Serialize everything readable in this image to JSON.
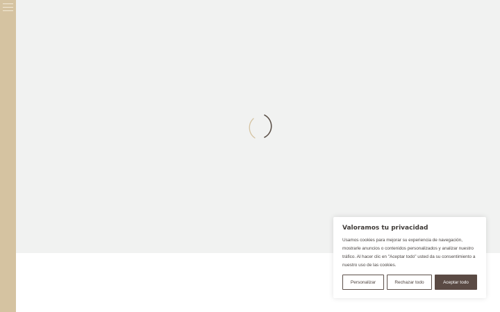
{
  "cookie_banner": {
    "title": "Valoramos tu privacidad",
    "text": "Usamos cookies para mejorar su experiencia de navegación, mostrarle anuncios o contenidos personalizados y analizar nuestro tráfico. Al hacer clic en \"Aceptar todo\" usted da su consentimiento a nuestro uso de las cookies.",
    "customize_label": "Personalizar",
    "reject_label": "Rechazar todo",
    "accept_label": "Aceptar todo"
  },
  "colors": {
    "sidebar": "#d5c3a1",
    "page_background": "#f1f2f1",
    "accept_button": "#5a4a44"
  },
  "icons": {
    "menu": "hamburger-menu-icon",
    "loading": "loading-spinner-icon"
  }
}
